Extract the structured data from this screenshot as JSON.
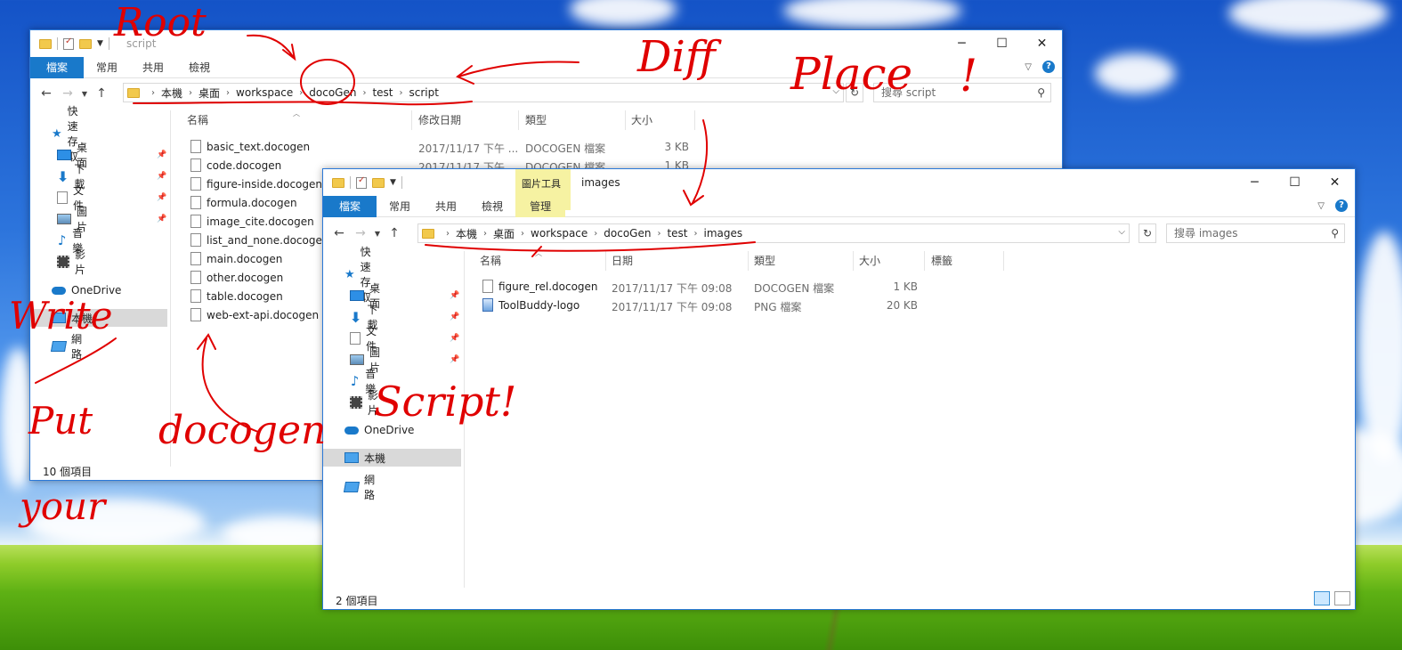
{
  "annotations": [
    "Root",
    "Diff",
    "Place",
    "!",
    "Write",
    "Put",
    "your",
    "docogen",
    "Script!"
  ],
  "window_back": {
    "title": "script",
    "ribbon_tabs": [
      "檔案",
      "常用",
      "共用",
      "檢視"
    ],
    "breadcrumb": [
      "本機",
      "桌面",
      "workspace",
      "docoGen",
      "test",
      "script"
    ],
    "search_placeholder": "搜尋 script",
    "nav": {
      "quick_access": "快速存取",
      "items": [
        "桌面",
        "下載",
        "文件",
        "圖片",
        "音樂",
        "影片"
      ],
      "onedrive": "OneDrive",
      "this_pc": "本機",
      "network": "網路"
    },
    "columns": [
      "名稱",
      "修改日期",
      "類型",
      "大小"
    ],
    "files": [
      {
        "name": "basic_text.docogen",
        "date": "2017/11/17 下午 ...",
        "type": "DOCOGEN 檔案",
        "size": "3 KB"
      },
      {
        "name": "code.docogen",
        "date": "2017/11/17 下午 ...",
        "type": "DOCOGEN 檔案",
        "size": "1 KB"
      },
      {
        "name": "figure-inside.docogen",
        "date": "",
        "type": "",
        "size": ""
      },
      {
        "name": "formula.docogen",
        "date": "",
        "type": "",
        "size": ""
      },
      {
        "name": "image_cite.docogen",
        "date": "",
        "type": "",
        "size": ""
      },
      {
        "name": "list_and_none.docogen",
        "date": "",
        "type": "",
        "size": ""
      },
      {
        "name": "main.docogen",
        "date": "",
        "type": "",
        "size": ""
      },
      {
        "name": "other.docogen",
        "date": "",
        "type": "",
        "size": ""
      },
      {
        "name": "table.docogen",
        "date": "",
        "type": "",
        "size": ""
      },
      {
        "name": "web-ext-api.docogen",
        "date": "",
        "type": "",
        "size": ""
      }
    ],
    "status": "10 個項目"
  },
  "window_front": {
    "title": "images",
    "context_tab_group": "圖片工具",
    "ribbon_tabs": [
      "檔案",
      "常用",
      "共用",
      "檢視",
      "管理"
    ],
    "breadcrumb": [
      "本機",
      "桌面",
      "workspace",
      "docoGen",
      "test",
      "images"
    ],
    "search_placeholder": "搜尋 images",
    "nav": {
      "quick_access": "快速存取",
      "items": [
        "桌面",
        "下載",
        "文件",
        "圖片",
        "音樂",
        "影片"
      ],
      "onedrive": "OneDrive",
      "this_pc": "本機",
      "network": "網路"
    },
    "columns": [
      "名稱",
      "日期",
      "類型",
      "大小",
      "標籤"
    ],
    "files": [
      {
        "name": "figure_rel.docogen",
        "date": "2017/11/17 下午 09:08",
        "type": "DOCOGEN 檔案",
        "size": "1 KB",
        "icon": "file-icon"
      },
      {
        "name": "ToolBuddy-logo",
        "date": "2017/11/17 下午 09:08",
        "type": "PNG 檔案",
        "size": "20 KB",
        "icon": "png-file-icon"
      }
    ],
    "status": "2 個項目"
  },
  "icons": {
    "minimize": "minimize-icon",
    "maximize": "maximize-icon",
    "close": "close-icon",
    "back": "back-arrow-icon",
    "forward": "forward-arrow-icon",
    "up": "up-arrow-icon",
    "refresh": "refresh-icon",
    "search": "search-icon",
    "help": "help-icon"
  },
  "colors": {
    "file_tab": "#1979ca",
    "context_tab": "#f6f2a2",
    "window_border": "#2b79d8",
    "annotation_ink": "#e00000"
  }
}
